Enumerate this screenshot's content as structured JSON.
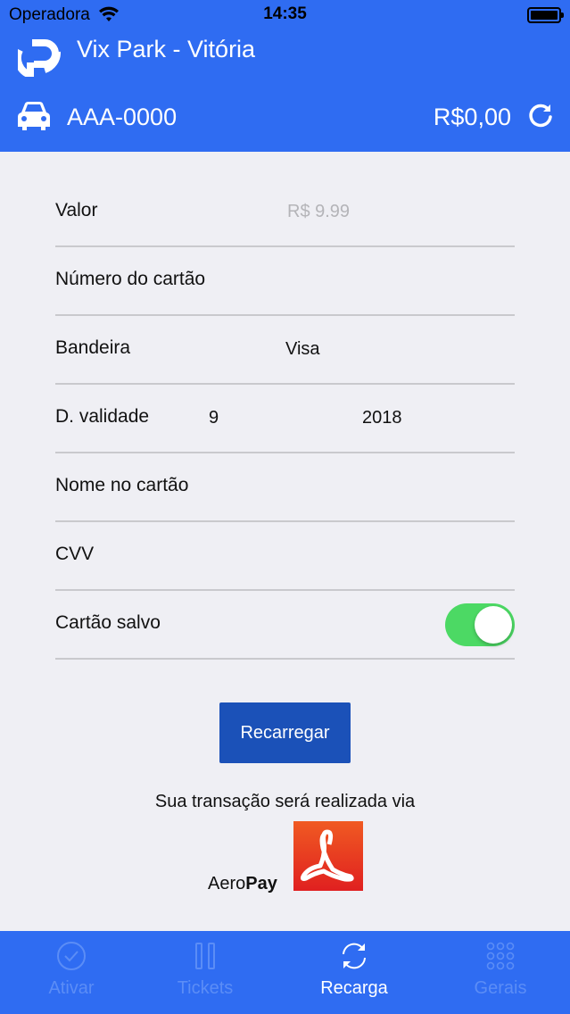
{
  "status": {
    "carrier": "Operadora",
    "time": "14:35"
  },
  "header": {
    "title": "Vix Park - Vitória",
    "plate": "AAA-0000",
    "balance": "R$0,00"
  },
  "form": {
    "valor_label": "Valor",
    "valor_placeholder": "R$ 9.99",
    "numero_label": "Número do cartão",
    "bandeira_label": "Bandeira",
    "bandeira_value": "Visa",
    "validade_label": "D. validade",
    "validade_month": "9",
    "validade_year": "2018",
    "nome_label": "Nome no cartão",
    "cvv_label": "CVV",
    "salvo_label": "Cartão salvo",
    "salvo_on": true
  },
  "action": {
    "button_label": "Recarregar",
    "via_text": "Sua transação será realizada via",
    "aero_prefix": "Aero",
    "aero_suffix": "Pay"
  },
  "tabs": [
    {
      "label": "Ativar",
      "icon": "check-circle-icon"
    },
    {
      "label": "Tickets",
      "icon": "pause-bars-icon"
    },
    {
      "label": "Recarga",
      "icon": "refresh-icon"
    },
    {
      "label": "Gerais",
      "icon": "grid-dots-icon"
    }
  ],
  "colors": {
    "brand": "#2f6cf2",
    "button": "#1b51b8",
    "toggle": "#4cd964",
    "tab_inactive": "#5b8df6"
  }
}
